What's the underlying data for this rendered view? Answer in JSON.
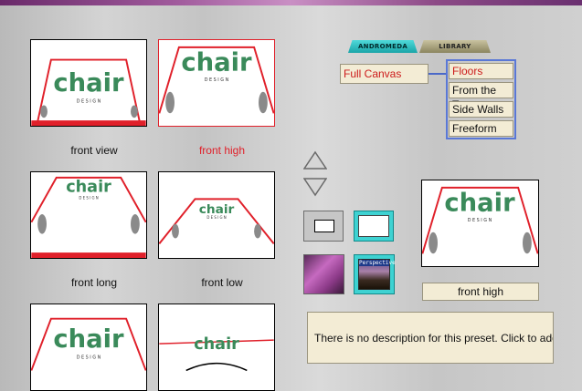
{
  "tabs": {
    "active": "ANDROMEDA",
    "inactive": "LIBRARY"
  },
  "mode": {
    "value": "Full Canvas"
  },
  "options": [
    "Floors",
    "From the Top",
    "Side Walls",
    "Freeform"
  ],
  "selected_option": "Floors",
  "presets": [
    {
      "label": "front view",
      "selected": false
    },
    {
      "label": "front high",
      "selected": true
    },
    {
      "label": "front long",
      "selected": false
    },
    {
      "label": "front low",
      "selected": false
    },
    {
      "label": "",
      "selected": false
    },
    {
      "label": "",
      "selected": false
    }
  ],
  "artwork": {
    "logo_text": "chair",
    "sub_text": "D E S I G N"
  },
  "preview": {
    "name": "front high"
  },
  "description": "There is no description for this preset. Click to add one",
  "buttons": {
    "perspective_caption": "Perspective"
  },
  "colors": {
    "accent_red": "#e0202a",
    "logo_green": "#3a8a5a",
    "tab_active": "#2ec4c4",
    "option_outline": "#5a78d6"
  }
}
